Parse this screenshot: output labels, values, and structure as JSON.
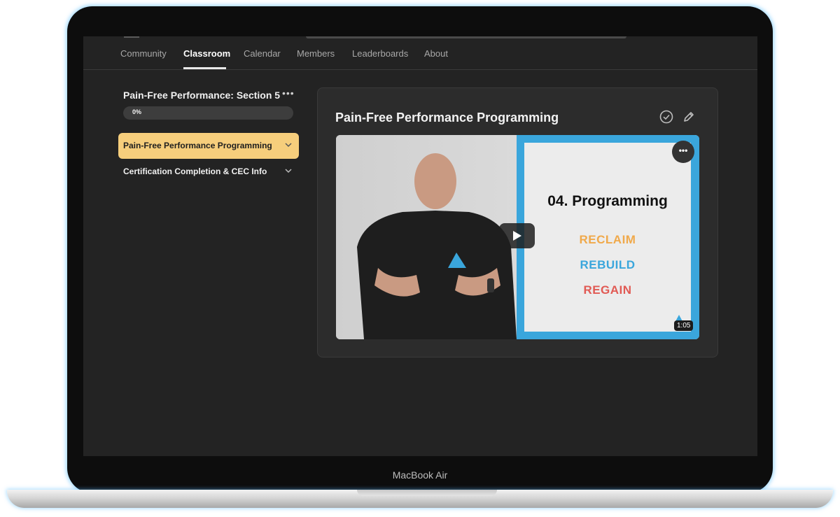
{
  "nav": {
    "tabs": [
      {
        "label": "Community"
      },
      {
        "label": "Classroom"
      },
      {
        "label": "Calendar"
      },
      {
        "label": "Members"
      },
      {
        "label": "Leaderboards"
      },
      {
        "label": "About"
      }
    ],
    "active_tab": "Classroom"
  },
  "course": {
    "title": "Pain-Free Performance: Section 5",
    "progress_text": "0%",
    "progress_value": 0,
    "lessons": [
      {
        "label": "Pain-Free Performance Programming",
        "active": true
      },
      {
        "label": "Certification Completion & CEC Info",
        "active": false
      }
    ]
  },
  "lesson_card": {
    "title": "Pain-Free Performance Programming",
    "icons": [
      "check-circle-icon",
      "pencil-icon",
      "play-icon",
      "more-icon"
    ],
    "video": {
      "slide_heading": "04. Programming",
      "slide_words": [
        "RECLAIM",
        "REBUILD",
        "REGAIN"
      ],
      "duration": "1:05"
    }
  },
  "colors": {
    "accent_lesson": "#f6ce7c",
    "reclaim": "#f0a94a",
    "rebuild": "#3aa6dc",
    "regain": "#e15a54",
    "slide_border": "#3aa6dc"
  },
  "device_label": "MacBook Air"
}
